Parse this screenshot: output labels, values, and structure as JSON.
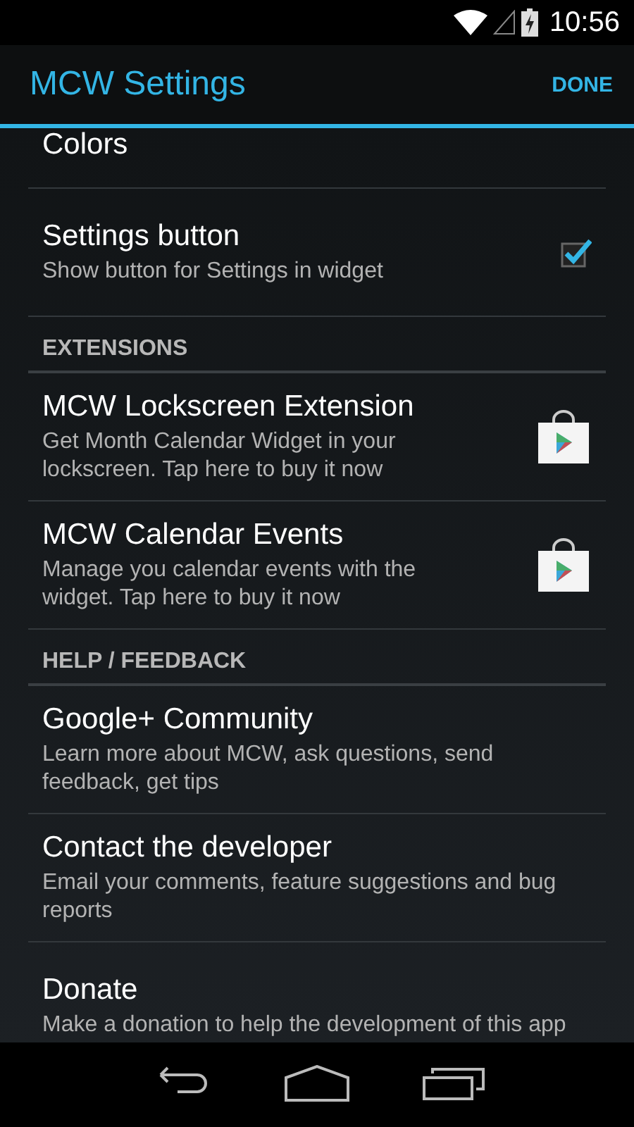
{
  "status_bar": {
    "time": "10:56"
  },
  "action_bar": {
    "title": "MCW Settings",
    "action": "DONE"
  },
  "items": [
    {
      "kind": "pref",
      "title": "Colors"
    },
    {
      "kind": "check",
      "title": "Settings button",
      "summary": "Show button for Settings in widget",
      "checked": true
    },
    {
      "kind": "header",
      "title": "EXTENSIONS"
    },
    {
      "kind": "store",
      "title": "MCW Lockscreen Extension",
      "summary": "Get Month Calendar Widget in your lockscreen. Tap here to buy it now"
    },
    {
      "kind": "store",
      "title": "MCW Calendar Events",
      "summary": "Manage you calendar events with the widget. Tap here to buy it now"
    },
    {
      "kind": "header",
      "title": "HELP / FEEDBACK"
    },
    {
      "kind": "pref",
      "title": "Google+ Community",
      "summary": "Learn more about MCW, ask questions, send feedback, get tips"
    },
    {
      "kind": "pref",
      "title": "Contact the developer",
      "summary": "Email your comments, feature suggestions and bug reports"
    },
    {
      "kind": "pref",
      "title": "Donate",
      "summary": "Make a donation to help the development of this app"
    }
  ]
}
